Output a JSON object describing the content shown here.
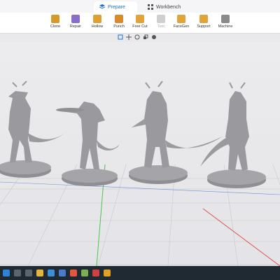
{
  "tabs": [
    {
      "label": "Prepare",
      "active": true
    },
    {
      "label": "Workbench",
      "active": false
    }
  ],
  "toolbar": {
    "tools": [
      {
        "label": "Clone",
        "icon": "clone-icon",
        "color": "#d59a2b"
      },
      {
        "label": "Repair",
        "icon": "repair-icon",
        "color": "#8a6cc9"
      },
      {
        "label": "Hollow",
        "icon": "hollow-icon",
        "color": "#e0a030"
      },
      {
        "label": "Punch",
        "icon": "punch-icon",
        "color": "#d98a2a"
      },
      {
        "label": "Free Cut",
        "icon": "free-cut-icon",
        "color": "#e2a43a"
      },
      {
        "label": "Text",
        "icon": "text-icon",
        "color": "#c8c8c8",
        "disabled": true
      },
      {
        "label": "FaceGen",
        "icon": "facegen-icon",
        "color": "#e2a43a"
      },
      {
        "label": "Support",
        "icon": "support-icon",
        "color": "#e2a43a"
      },
      {
        "label": "Machine",
        "icon": "machine-icon",
        "color": "#8a8a8a"
      }
    ]
  },
  "subtools": [
    "select-tool-icon",
    "move-tool-icon",
    "rotate-tool-icon",
    "scale-tool-icon",
    "view-tool-icon"
  ],
  "colors": {
    "accent": "#1d6fd8",
    "model": "#9a9a9e",
    "grid": "#c8c8cc",
    "axis_green": "#4ec24e",
    "axis_red": "#e05050",
    "taskbar": "#1f2a33"
  },
  "taskbar": {
    "icons": [
      "windows-icon",
      "search-icon",
      "task-view-icon",
      "file-explorer-icon",
      "browser-icon",
      "store-icon",
      "mail-icon",
      "app-icon",
      "slicer-icon",
      "chrome-icon"
    ]
  }
}
